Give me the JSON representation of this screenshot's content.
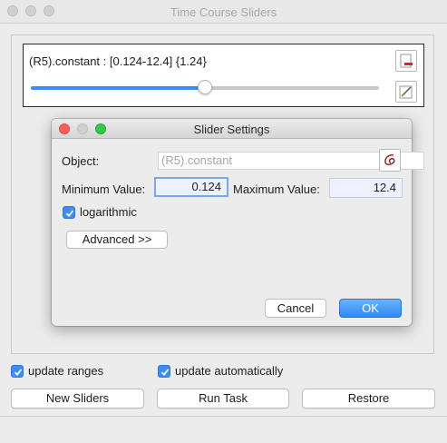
{
  "window": {
    "title": "Time Course Sliders"
  },
  "slider": {
    "label": "(R5).constant : [0.124-12.4] {1.24}",
    "position_fraction": 0.5,
    "accent_color": "#3d8df5"
  },
  "side_buttons": {
    "remove_icon": "remove-slider-icon",
    "edit_icon": "edit-slider-icon"
  },
  "dialog": {
    "title": "Slider Settings",
    "object_label": "Object:",
    "object_placeholder": "(R5).constant",
    "min_label": "Minimum Value:",
    "min_value": "0.124",
    "max_label": "Maximum Value:",
    "max_value": "12.4",
    "log_label": "logarithmic",
    "log_checked": true,
    "advanced_label": "Advanced >>",
    "cancel_label": "Cancel",
    "ok_label": "OK"
  },
  "options": {
    "update_ranges_label": "update ranges",
    "update_auto_label": "update automatically"
  },
  "buttons": {
    "new_sliders": "New Sliders",
    "run_task": "Run Task",
    "restore": "Restore"
  }
}
